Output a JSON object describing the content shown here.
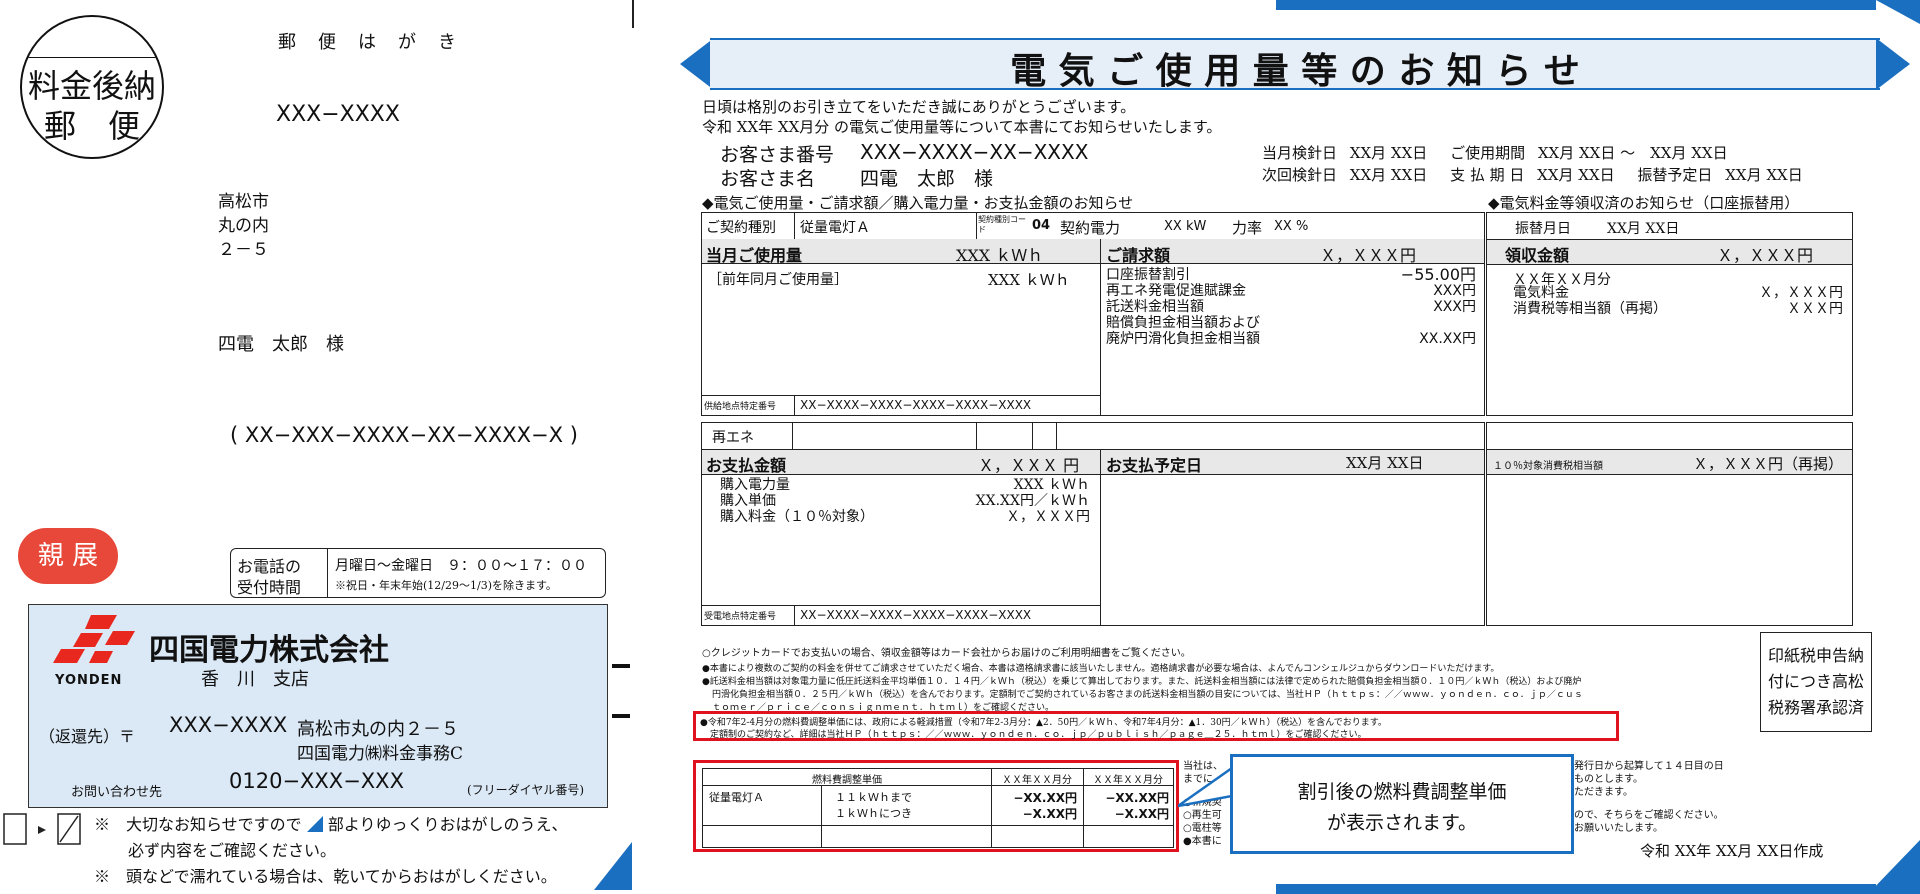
{
  "postcard": {
    "stamp_line1": "料金後納",
    "stamp_line2": "郵　便",
    "postcard_label": "郵　便　は　が　き",
    "postal_code": "XXX−XXXX",
    "address_lines": [
      "高松市",
      "丸の内",
      "２－５"
    ],
    "recipient": "四電　太郎　様",
    "customer_code": "( XX−XXX−XXXX−XX−XXXX−X )",
    "personal_badge": "親 展",
    "phone_hours_label_1": "お電話の",
    "phone_hours_label_2": "受付時間",
    "phone_hours": "月曜日～金曜日　９：００～１７：００",
    "phone_hours_note": "※祝日・年末年始(12/29～1/3)を除きます。",
    "company_name": "四国電力株式会社",
    "company_logo_text": "YONDEN",
    "branch": "香　川　支店",
    "return_label": "（返還先）〒",
    "return_postal": "XXX−XXXX",
    "return_address_1": "高松市丸の内２－５",
    "return_address_2": "四国電力㈱料金事務C",
    "contact_label": "お問い合わせ先",
    "contact_phone": "0120−XXX−XXX",
    "contact_note": "(フリーダイヤル番号)",
    "note1a": "※　大切なお知らせですので",
    "note1b": "部よりゆっくりおはがしのうえ、",
    "note1c": "必ず内容をご確認ください。",
    "note2": "※　頭などで濡れている場合は、乾いてからおはがしください。"
  },
  "notice": {
    "title": "電 気 ご 使 用 量 等 の お 知 ら せ",
    "greeting_1": "日頃は格別のお引き立てをいただき誠にありがとうございます。",
    "greeting_2": "令和 XX年 XX月分 の電気ご使用量等について本書にてお知らせいたします。",
    "customer_no_label": "お客さま番号",
    "customer_no": "XXX−XXXX−XX−XXXX",
    "customer_name_label": "お客さま名",
    "customer_name": "四電　太郎　様",
    "meter_date_label": "当月検針日",
    "meter_date": "XX月 XX日",
    "usage_period_label": "ご使用期間",
    "usage_period": "XX月 XX日 ～　XX月 XX日",
    "next_meter_label": "次回検針日",
    "next_meter": "XX月 XX日",
    "payment_date_label": "支 払 期 日",
    "payment_date": "XX月 XX日",
    "transfer_date_label": "振替予定日",
    "transfer_date": "XX月 XX日",
    "section_left": "◆電気ご使用量・ご請求額／購入電力量・お支払金額のお知らせ",
    "section_right": "◆電気料金等領収済のお知らせ（口座振替用）"
  },
  "contract": {
    "type_label": "ご契約種別",
    "type_value": "従量電灯Ａ",
    "code_label": "契約種別コード",
    "code_value": "04",
    "power_label": "契約電力",
    "power_value": "XX kW",
    "pf_label": "力率",
    "pf_value": "XX %"
  },
  "usage": {
    "label": "当月ご使用量",
    "value": "XXX ｋＷｈ",
    "prev_label": "［前年同月ご使用量］",
    "prev_value": "XXX ｋＷｈ",
    "supply_label": "供給地点特定番号",
    "supply_value": "XX−XXXX−XXXX−XXXX−XXXX−XXXX"
  },
  "billing": {
    "label": "ご請求額",
    "value": "Ｘ，ＸＸＸ円",
    "items": [
      {
        "name": "口座振替割引",
        "value": "−55.00円"
      },
      {
        "name": "再エネ発電促進賦課金",
        "value": "XXX円"
      },
      {
        "name": "託送料金相当額",
        "value": "XXX円"
      },
      {
        "name": "賠償負担金相当額および",
        "value": ""
      },
      {
        "name": "廃炉円滑化負担金相当額",
        "value": "XX.XX円"
      }
    ]
  },
  "receipt": {
    "transfer_label": "振替月日",
    "transfer_value": "XX月 XX日",
    "amount_label": "領収金額",
    "amount_value": "Ｘ，ＸＸＸ円",
    "month_label": "ＸＸ年ＸＸ月分",
    "items": [
      {
        "name": "電気料金",
        "value": "Ｘ，ＸＸＸ円"
      },
      {
        "name": "消費税等相当額（再掲）",
        "value": "ＸＸＸ円"
      }
    ]
  },
  "purchase": {
    "renewable_label": "再エネ",
    "pay_label": "お支払金額",
    "pay_value": "Ｘ，ＸＸＸ 円",
    "items": [
      {
        "name": "購入電力量",
        "value": "XXX ｋＷｈ"
      },
      {
        "name": "購入単価",
        "value": "XX.XX円／ｋＷｈ"
      },
      {
        "name": "購入料金（１０％対象）",
        "value": "Ｘ，ＸＸＸ円"
      }
    ],
    "receive_label": "受電地点特定番号",
    "receive_value": "XX−XXXX−XXXX−XXXX−XXXX−XXXX",
    "schedule_label": "お支払予定日",
    "schedule_value": "XX月 XX日",
    "tax_label": "１０％対象消費税相当額",
    "tax_value": "Ｘ，ＸＸＸ円（再掲）"
  },
  "notes": {
    "line1": "○クレジットカードでお支払いの場合、領収金額等はカード会社からお届けのご利用明細書をご覧ください。",
    "line2": "●本書により複数のご契約の料金を併せてご請求させていただく場合、本書は適格請求書に該当いたしません。適格請求書が必要な場合は、よんでんコンシェルジュからダウンロードいただけます。",
    "line3": "●託送料金相当額は対象電力量に低圧託送料金平均単価１０．１４円／ｋＷｈ（税込）を乗じて算出しております。また、託送料金相当額には法律で定められた賠償負担金相当額０．１０円／ｋＷｈ（税込）および廃炉",
    "line4": "円滑化負担金相当額０．２５円／ｋＷｈ（税込）を含んでおります。定額制でご契約されているお客さまの託送料金相当額の目安については、当社ＨＰ（ｈｔｔｐｓ：／／ｗｗｗ．ｙｏｎｄｅｎ．ｃｏ．ｊｐ／ｃｕｓ",
    "line5": "ｔｏｍｅｒ／ｐｒｉｃｅ／ｃｏｎｓｉｇｎｍｅｎｔ．ｈｔｍｌ）をご確認ください。",
    "highlight_1": "●令和7年2-4月分の燃料費調整単価には、政府による軽減措置（令和7年2-3月分：▲2．50円／ｋＷｈ、令和7年4月分：▲1．30円／ｋＷｈ）（税込）を含んでおります。",
    "highlight_2": "定額制のご契約など、詳細は当社ＨＰ（ｈｔｔｐｓ：／／ｗｗｗ．ｙｏｎｄｅｎ．ｃｏ．ｊｐ／ｐｕｂｌｉｓｈ／ｐａｇｅ＿２５．ｈｔｍｌ）をご確認ください。",
    "stamp_1": "印紙税申告納",
    "stamp_2": "付につき高松",
    "stamp_3": "税務署承認済"
  },
  "fuel_table": {
    "header": "燃料費調整単価",
    "col1": "ＸＸ年ＸＸ月分",
    "col2": "ＸＸ年ＸＸ月分",
    "plan": "従量電灯Ａ",
    "row1_label": "１１ｋＷｈまで",
    "row1_v1": "−XX.XX円",
    "row1_v2": "−XX.XX円",
    "row2_label": "１ｋＷｈにつき",
    "row2_v1": "−X.XX円",
    "row2_v2": "−X.XX円"
  },
  "callout": {
    "line1": "割引後の燃料費調整単価",
    "line2": "が表示されます。"
  },
  "right_notes": {
    "l1": "当社は、",
    "l2": "までに",
    "l3": "○新規契",
    "l4": "○再生可",
    "l5": "○電柱等",
    "l6": "●本書に",
    "r1": "発行日から起算して１４日目の日",
    "r2": "ものとします。",
    "r3": "ただきます。",
    "r4": "ので、そちらをご確認ください。",
    "r5": "お願いいたします。"
  },
  "created": "令和 XX年 XX月 XX日作成",
  "colors": {
    "accent_blue": "#1a6fc0",
    "highlight_red": "#e0121e",
    "badge_red": "#e8483a",
    "panel_blue": "#dbe8f5"
  }
}
